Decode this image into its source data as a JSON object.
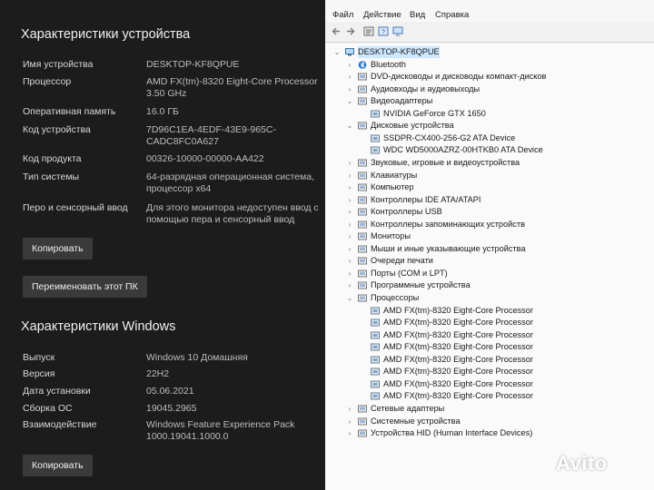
{
  "device": {
    "title": "Характеристики устройства",
    "rows": [
      {
        "key": "Имя устройства",
        "value": "DESKTOP-KF8QPUE"
      },
      {
        "key": "Процессор",
        "value": "AMD FX(tm)-8320 Eight-Core Processor 3.50 GHz"
      },
      {
        "key": "Оперативная память",
        "value": "16.0 ГБ"
      },
      {
        "key": "Код устройства",
        "value": "7D96C1EA-4EDF-43E9-965C-CADC8FC0A627"
      },
      {
        "key": "Код продукта",
        "value": "00326-10000-00000-AA422"
      },
      {
        "key": "Тип системы",
        "value": "64-разрядная операционная система, процессор x64"
      },
      {
        "key": "Перо и сенсорный ввод",
        "value": "Для этого монитора недоступен ввод с помощью пера и сенсорный ввод"
      }
    ],
    "copy_label": "Копировать",
    "rename_label": "Переименовать этот ПК"
  },
  "windows": {
    "title": "Характеристики Windows",
    "rows": [
      {
        "key": "Выпуск",
        "value": "Windows 10 Домашняя"
      },
      {
        "key": "Версия",
        "value": "22H2"
      },
      {
        "key": "Дата установки",
        "value": "05.06.2021"
      },
      {
        "key": "Сборка ОС",
        "value": "19045.2965"
      },
      {
        "key": "Взаимодействие",
        "value": "Windows Feature Experience Pack 1000.19041.1000.0"
      }
    ],
    "copy_label": "Копировать"
  },
  "devmgr": {
    "menu": [
      "Файл",
      "Действие",
      "Вид",
      "Справка"
    ],
    "root": "DESKTOP-KF8QPUE",
    "nodes": [
      {
        "label": "Bluetooth",
        "level": 1,
        "expander": "›"
      },
      {
        "label": "DVD-дисководы и дисководы компакт-дисков",
        "level": 1,
        "expander": "›"
      },
      {
        "label": "Аудиовходы и аудиовыходы",
        "level": 1,
        "expander": "›"
      },
      {
        "label": "Видеоадаптеры",
        "level": 1,
        "expander": "⌄"
      },
      {
        "label": "NVIDIA GeForce GTX 1650",
        "level": 2,
        "expander": ""
      },
      {
        "label": "Дисковые устройства",
        "level": 1,
        "expander": "⌄"
      },
      {
        "label": "SSDPR-CX400-256-G2 ATA Device",
        "level": 2,
        "expander": ""
      },
      {
        "label": "WDC WD5000AZRZ-00HTKB0 ATA Device",
        "level": 2,
        "expander": ""
      },
      {
        "label": "Звуковые, игровые и видеоустройства",
        "level": 1,
        "expander": "›"
      },
      {
        "label": "Клавиатуры",
        "level": 1,
        "expander": "›"
      },
      {
        "label": "Компьютер",
        "level": 1,
        "expander": "›"
      },
      {
        "label": "Контроллеры IDE ATA/ATAPI",
        "level": 1,
        "expander": "›"
      },
      {
        "label": "Контроллеры USB",
        "level": 1,
        "expander": "›"
      },
      {
        "label": "Контроллеры запоминающих устройств",
        "level": 1,
        "expander": "›"
      },
      {
        "label": "Мониторы",
        "level": 1,
        "expander": "›"
      },
      {
        "label": "Мыши и иные указывающие устройства",
        "level": 1,
        "expander": "›"
      },
      {
        "label": "Очереди печати",
        "level": 1,
        "expander": "›"
      },
      {
        "label": "Порты (COM и LPT)",
        "level": 1,
        "expander": "›"
      },
      {
        "label": "Программные устройства",
        "level": 1,
        "expander": "›"
      },
      {
        "label": "Процессоры",
        "level": 1,
        "expander": "⌄"
      },
      {
        "label": "AMD FX(tm)-8320 Eight-Core Processor",
        "level": 2,
        "expander": ""
      },
      {
        "label": "AMD FX(tm)-8320 Eight-Core Processor",
        "level": 2,
        "expander": ""
      },
      {
        "label": "AMD FX(tm)-8320 Eight-Core Processor",
        "level": 2,
        "expander": ""
      },
      {
        "label": "AMD FX(tm)-8320 Eight-Core Processor",
        "level": 2,
        "expander": ""
      },
      {
        "label": "AMD FX(tm)-8320 Eight-Core Processor",
        "level": 2,
        "expander": ""
      },
      {
        "label": "AMD FX(tm)-8320 Eight-Core Processor",
        "level": 2,
        "expander": ""
      },
      {
        "label": "AMD FX(tm)-8320 Eight-Core Processor",
        "level": 2,
        "expander": ""
      },
      {
        "label": "AMD FX(tm)-8320 Eight-Core Processor",
        "level": 2,
        "expander": ""
      },
      {
        "label": "Сетевые адаптеры",
        "level": 1,
        "expander": "›"
      },
      {
        "label": "Системные устройства",
        "level": 1,
        "expander": "›"
      },
      {
        "label": "Устройства HID (Human Interface Devices)",
        "level": 1,
        "expander": "›"
      }
    ]
  },
  "watermark": "Avito",
  "colors": {
    "accent": "#0078d4",
    "panel_bg": "#1c1c1c",
    "button_bg": "#3a3a3a"
  }
}
